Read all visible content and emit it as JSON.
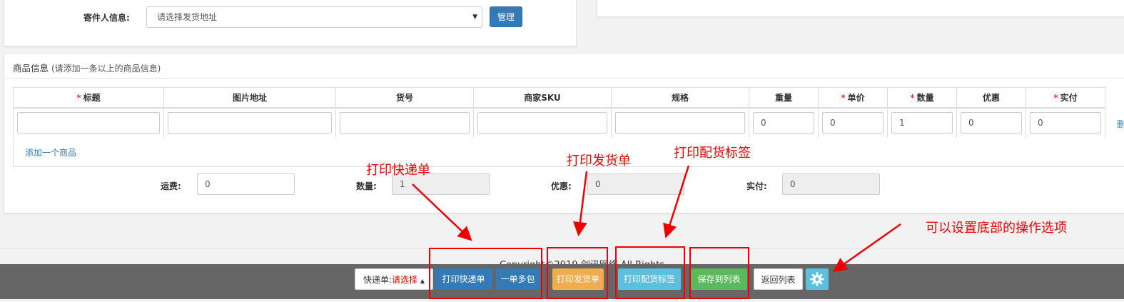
{
  "sender": {
    "label": "寄件人信息:",
    "select_value": "请选择发货地址",
    "manage_button": "管理"
  },
  "goods": {
    "title": "商品信息",
    "title_hint": "(请添加一条以上的商品信息)",
    "columns": [
      "标题",
      "图片地址",
      "货号",
      "商家SKU",
      "规格",
      "重量",
      "单价",
      "数量",
      "优惠",
      "实付"
    ],
    "required_marker": "*",
    "row": {
      "title": "",
      "image_url": "",
      "item_no": "",
      "sku": "",
      "spec": "",
      "weight": "0",
      "unit_price": "0",
      "quantity": "1",
      "discount": "0",
      "paid": "0"
    },
    "delete_link": "删",
    "add_link": "添加一个商品"
  },
  "summary": {
    "freight_label": "运费:",
    "freight_value": "0",
    "quantity_label": "数量:",
    "quantity_value": "1",
    "discount_label": "优惠:",
    "discount_value": "0",
    "paid_label": "实付:",
    "paid_value": "0"
  },
  "footer": {
    "copyright": "Copyright©2019 剑讯网络 All Rights."
  },
  "bottom_bar": {
    "express_label": "快递单:",
    "express_value": "请选择",
    "print_express": "打印快递单",
    "one_order_multi": "一单多包",
    "print_invoice": "打印发货单",
    "print_pick_label": "打印配货标签",
    "save_to_list": "保存到列表",
    "back_to_list": "返回列表",
    "settings_icon": "gear-icon"
  },
  "annotations": {
    "print_express": "打印快递单",
    "print_invoice": "打印发货单",
    "print_pick_label": "打印配货标签",
    "settings_hint": "可以设置底部的操作选项"
  },
  "colors": {
    "primary": "#337ab7",
    "warning": "#f0ad4e",
    "info": "#5bc0de",
    "success": "#5cb85c",
    "annotation": "#ee0000",
    "bar": "#666666"
  }
}
